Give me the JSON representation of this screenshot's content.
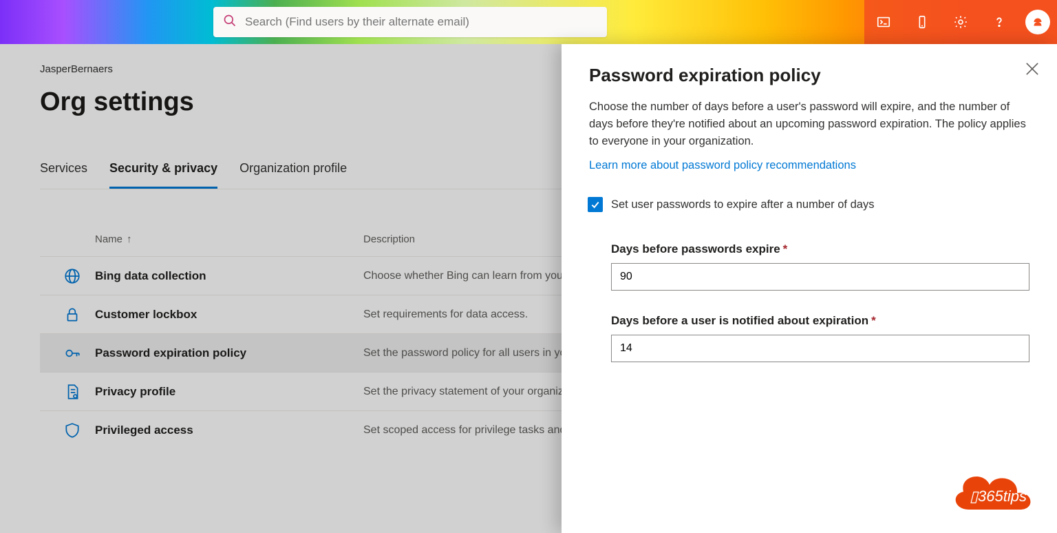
{
  "search": {
    "placeholder": "Search (Find users by their alternate email)"
  },
  "breadcrumb": "JasperBernaers",
  "page_title": "Org settings",
  "tabs": [
    {
      "label": "Services",
      "active": false
    },
    {
      "label": "Security & privacy",
      "active": true
    },
    {
      "label": "Organization profile",
      "active": false
    }
  ],
  "columns": {
    "name": "Name",
    "description": "Description"
  },
  "rows": [
    {
      "icon": "globe",
      "name": "Bing data collection",
      "desc": "Choose whether Bing can learn from your organization's searches.",
      "selected": false
    },
    {
      "icon": "lock",
      "name": "Customer lockbox",
      "desc": "Set requirements for data access.",
      "selected": false
    },
    {
      "icon": "key",
      "name": "Password expiration policy",
      "desc": "Set the password policy for all users in your organization.",
      "selected": true
    },
    {
      "icon": "doc",
      "name": "Privacy profile",
      "desc": "Set the privacy statement of your organization.",
      "selected": false
    },
    {
      "icon": "shield",
      "name": "Privileged access",
      "desc": "Set scoped access for privilege tasks and data.",
      "selected": false
    }
  ],
  "panel": {
    "title": "Password expiration policy",
    "description": "Choose the number of days before a user's password will expire, and the number of days before they're notified about an upcoming password expiration. The policy applies to everyone in your organization.",
    "link": "Learn more about password policy recommendations",
    "checkbox_label": "Set user passwords to expire after a number of days",
    "checkbox_checked": true,
    "field1_label": "Days before passwords expire",
    "field1_value": "90",
    "field2_label": "Days before a user is notified about expiration",
    "field2_value": "14"
  },
  "logo_text": "365tips"
}
